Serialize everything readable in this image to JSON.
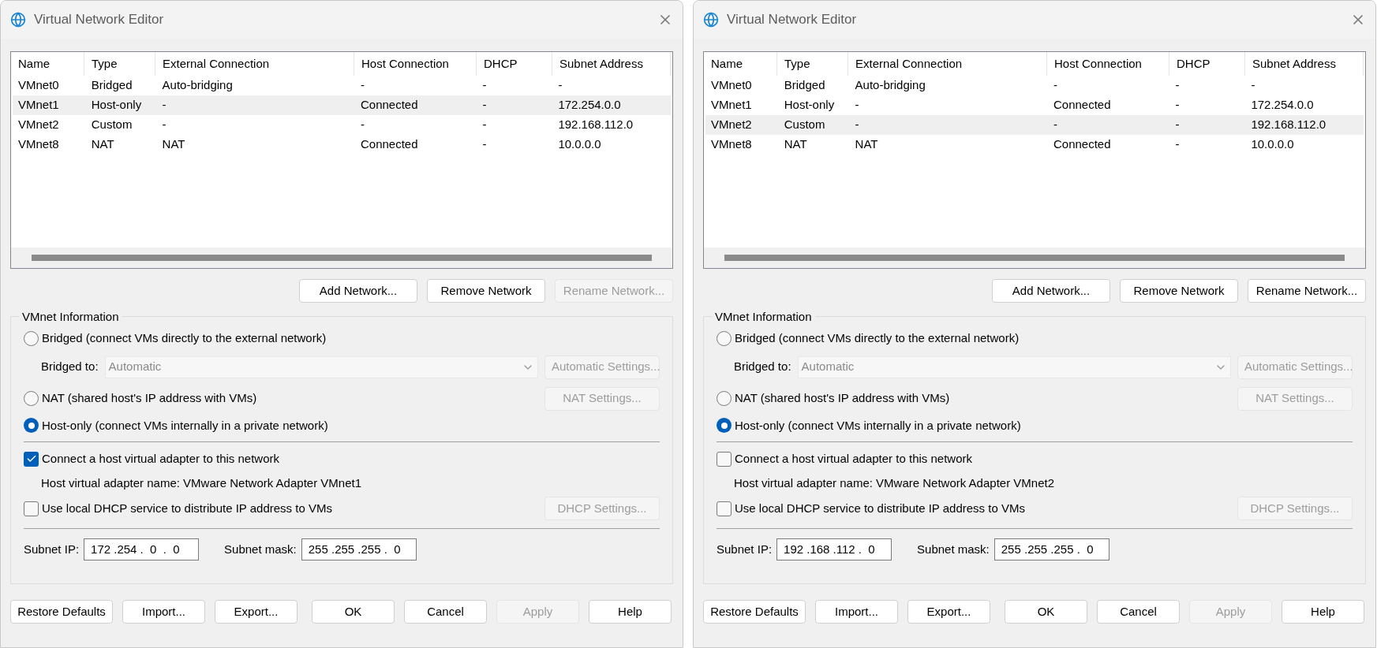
{
  "windows": [
    {
      "title": "Virtual Network Editor",
      "table": {
        "columns": [
          "Name",
          "Type",
          "External Connection",
          "Host Connection",
          "DHCP",
          "Subnet Address"
        ],
        "rows": [
          {
            "cells": [
              "VMnet0",
              "Bridged",
              "Auto-bridging",
              "-",
              "-",
              "-"
            ],
            "selected": false
          },
          {
            "cells": [
              "VMnet1",
              "Host-only",
              "-",
              "Connected",
              "-",
              "172.254.0.0"
            ],
            "selected": true
          },
          {
            "cells": [
              "VMnet2",
              "Custom",
              "-",
              "-",
              "-",
              "192.168.112.0"
            ],
            "selected": false
          },
          {
            "cells": [
              "VMnet8",
              "NAT",
              "NAT",
              "Connected",
              "-",
              "10.0.0.0"
            ],
            "selected": false
          }
        ]
      },
      "table_buttons": [
        {
          "label": "Add Network...",
          "disabled": false
        },
        {
          "label": "Remove Network",
          "disabled": false
        },
        {
          "label": "Rename Network...",
          "disabled": true
        }
      ],
      "info": {
        "legend": "VMnet Information",
        "modes": [
          {
            "label": "Bridged (connect VMs directly to the external network)",
            "selected": false
          },
          {
            "label": "NAT (shared host's IP address with VMs)",
            "selected": false
          },
          {
            "label": "Host-only (connect VMs internally in a private network)",
            "selected": true
          }
        ],
        "bridged_to_label": "Bridged to:",
        "bridged_to_value": "Automatic",
        "automatic_settings": {
          "label": "Automatic Settings...",
          "disabled": true
        },
        "nat_settings": {
          "label": "NAT Settings...",
          "disabled": true
        },
        "connect_adapter": {
          "label": "Connect a host virtual adapter to this network",
          "checked": true
        },
        "adapter_name": "Host virtual adapter name: VMware Network Adapter VMnet1",
        "dhcp": {
          "label": "Use local DHCP service to distribute IP address to VMs",
          "checked": false
        },
        "dhcp_settings": {
          "label": "DHCP Settings...",
          "disabled": true
        },
        "subnet_ip_label": "Subnet IP:",
        "subnet_ip": "172 .254 .  0  .  0",
        "subnet_mask_label": "Subnet mask:",
        "subnet_mask": "255 .255 .255 .  0"
      },
      "footer_buttons": [
        {
          "label": "Restore Defaults",
          "disabled": false
        },
        {
          "label": "Import...",
          "disabled": false
        },
        {
          "label": "Export...",
          "disabled": false
        },
        {
          "label": "OK",
          "disabled": false
        },
        {
          "label": "Cancel",
          "disabled": false
        },
        {
          "label": "Apply",
          "disabled": true
        },
        {
          "label": "Help",
          "disabled": false
        }
      ]
    },
    {
      "title": "Virtual Network Editor",
      "table": {
        "columns": [
          "Name",
          "Type",
          "External Connection",
          "Host Connection",
          "DHCP",
          "Subnet Address"
        ],
        "rows": [
          {
            "cells": [
              "VMnet0",
              "Bridged",
              "Auto-bridging",
              "-",
              "-",
              "-"
            ],
            "selected": false
          },
          {
            "cells": [
              "VMnet1",
              "Host-only",
              "-",
              "Connected",
              "-",
              "172.254.0.0"
            ],
            "selected": false
          },
          {
            "cells": [
              "VMnet2",
              "Custom",
              "-",
              "-",
              "-",
              "192.168.112.0"
            ],
            "selected": true
          },
          {
            "cells": [
              "VMnet8",
              "NAT",
              "NAT",
              "Connected",
              "-",
              "10.0.0.0"
            ],
            "selected": false
          }
        ]
      },
      "table_buttons": [
        {
          "label": "Add Network...",
          "disabled": false
        },
        {
          "label": "Remove Network",
          "disabled": false
        },
        {
          "label": "Rename Network...",
          "disabled": false
        }
      ],
      "info": {
        "legend": "VMnet Information",
        "modes": [
          {
            "label": "Bridged (connect VMs directly to the external network)",
            "selected": false
          },
          {
            "label": "NAT (shared host's IP address with VMs)",
            "selected": false
          },
          {
            "label": "Host-only (connect VMs internally in a private network)",
            "selected": true
          }
        ],
        "bridged_to_label": "Bridged to:",
        "bridged_to_value": "Automatic",
        "automatic_settings": {
          "label": "Automatic Settings...",
          "disabled": true
        },
        "nat_settings": {
          "label": "NAT Settings...",
          "disabled": true
        },
        "connect_adapter": {
          "label": "Connect a host virtual adapter to this network",
          "checked": false
        },
        "adapter_name": "Host virtual adapter name: VMware Network Adapter VMnet2",
        "dhcp": {
          "label": "Use local DHCP service to distribute IP address to VMs",
          "checked": false
        },
        "dhcp_settings": {
          "label": "DHCP Settings...",
          "disabled": true
        },
        "subnet_ip_label": "Subnet IP:",
        "subnet_ip": "192 .168 .112 .  0",
        "subnet_mask_label": "Subnet mask:",
        "subnet_mask": "255 .255 .255 .  0"
      },
      "footer_buttons": [
        {
          "label": "Restore Defaults",
          "disabled": false
        },
        {
          "label": "Import...",
          "disabled": false
        },
        {
          "label": "Export...",
          "disabled": false
        },
        {
          "label": "OK",
          "disabled": false
        },
        {
          "label": "Cancel",
          "disabled": false
        },
        {
          "label": "Apply",
          "disabled": true
        },
        {
          "label": "Help",
          "disabled": false
        }
      ]
    }
  ]
}
